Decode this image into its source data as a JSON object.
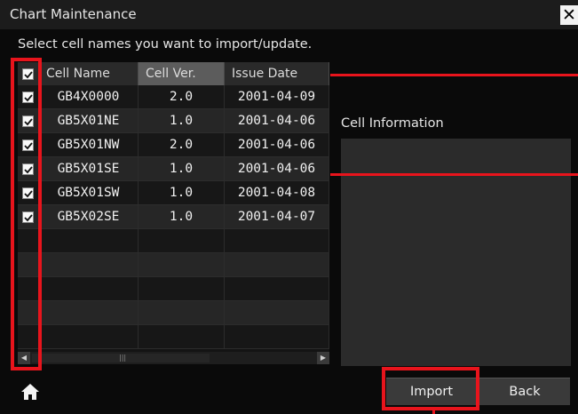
{
  "window": {
    "title": "Chart Maintenance",
    "close_label": "✕"
  },
  "instruction": "Select cell names you want to import/update.",
  "table": {
    "columns": [
      "Cell Name",
      "Cell Ver.",
      "Issue Date"
    ],
    "rows": [
      {
        "checked": true,
        "name": "GB4X0000",
        "ver": "2.0",
        "date": "2001-04-09"
      },
      {
        "checked": true,
        "name": "GB5X01NE",
        "ver": "1.0",
        "date": "2001-04-06"
      },
      {
        "checked": true,
        "name": "GB5X01NW",
        "ver": "2.0",
        "date": "2001-04-06"
      },
      {
        "checked": true,
        "name": "GB5X01SE",
        "ver": "1.0",
        "date": "2001-04-06"
      },
      {
        "checked": true,
        "name": "GB5X01SW",
        "ver": "1.0",
        "date": "2001-04-08"
      },
      {
        "checked": true,
        "name": "GB5X02SE",
        "ver": "1.0",
        "date": "2001-04-07"
      }
    ],
    "empty_rows": 5,
    "header_checked": true
  },
  "cell_info": {
    "label": "Cell Information"
  },
  "buttons": {
    "import": "Import",
    "back": "Back"
  },
  "icons": {
    "home": "home-icon",
    "close": "close-icon"
  },
  "colors": {
    "highlight": "#e8141c"
  }
}
